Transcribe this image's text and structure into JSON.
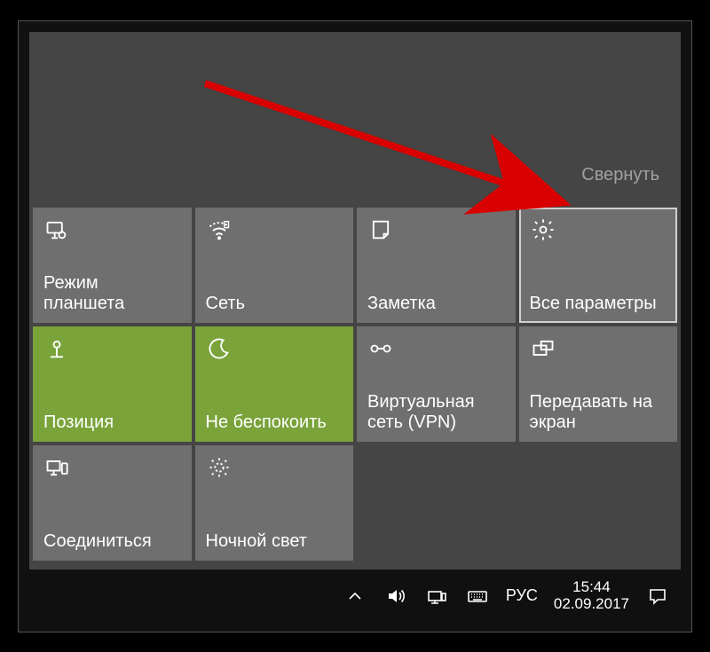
{
  "collapse_label": "Свернуть",
  "tiles": [
    {
      "label": "Режим планшета",
      "icon": "tablet-mode",
      "active": false,
      "highlight": false
    },
    {
      "label": "Сеть",
      "icon": "wifi",
      "active": false,
      "highlight": false
    },
    {
      "label": "Заметка",
      "icon": "note",
      "active": false,
      "highlight": false
    },
    {
      "label": "Все параметры",
      "icon": "gear",
      "active": false,
      "highlight": true
    },
    {
      "label": "Позиция",
      "icon": "location",
      "active": true,
      "highlight": false
    },
    {
      "label": "Не беспокоить",
      "icon": "moon",
      "active": true,
      "highlight": false
    },
    {
      "label": "Виртуальная сеть (VPN)",
      "icon": "vpn",
      "active": false,
      "highlight": false
    },
    {
      "label": "Передавать на экран",
      "icon": "project",
      "active": false,
      "highlight": false
    },
    {
      "label": "Соединиться",
      "icon": "connect",
      "active": false,
      "highlight": false
    },
    {
      "label": "Ночной свет",
      "icon": "nightlight",
      "active": false,
      "highlight": false
    }
  ],
  "taskbar": {
    "language": "РУС",
    "time": "15:44",
    "date": "02.09.2017"
  }
}
